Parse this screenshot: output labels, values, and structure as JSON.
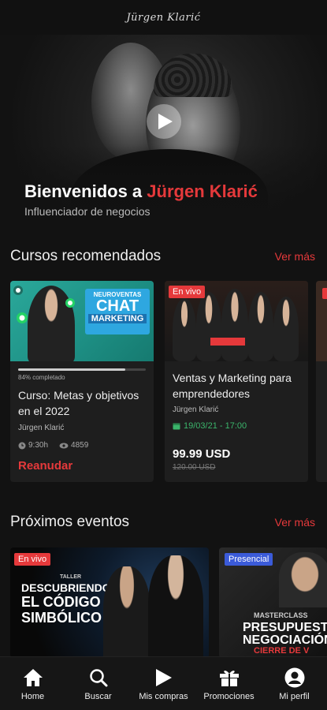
{
  "header": {
    "logo_text": "Jürgen Klarić"
  },
  "hero": {
    "title_prefix": "Bienvenidos a ",
    "title_highlight": "Jürgen Klarić",
    "subtitle": "Influenciador de negocios"
  },
  "courses": {
    "title": "Cursos recomendados",
    "see_more": "Ver más",
    "items": [
      {
        "thumb_small": "NEUROVENTAS",
        "thumb_big": "CHAT",
        "thumb_mid": "MARKETING",
        "progress_fraction": 0.84,
        "progress_label": "84% completado",
        "title": "Curso: Metas y objetivos en el 2022",
        "author": "Jürgen Klarić",
        "duration": "9:30h",
        "views": "4859",
        "action": "Reanudar"
      },
      {
        "badge": "En vivo",
        "title": "Ventas y Marketing para emprendedores",
        "author": "Jürgen Klarić",
        "date": "19/03/21 - 17:00",
        "price": "99.99 USD",
        "old_price": "120.00 USD"
      }
    ]
  },
  "events": {
    "title": "Próximos eventos",
    "see_more": "Ver más",
    "items": [
      {
        "badge": "En vivo",
        "kicker": "TALLER",
        "line1": "DESCUBRIENDO",
        "line2": "EL CÓDIGO",
        "line3": "SIMBÓLICO"
      },
      {
        "badge": "Presencial",
        "kicker": "MASTERCLASS",
        "line1": "PRESUPUESTO",
        "line2": "NEGOCIACIÓN",
        "line3": "CIERRE DE V"
      }
    ]
  },
  "nav": [
    {
      "label": "Home",
      "icon": "home-icon"
    },
    {
      "label": "Buscar",
      "icon": "search-icon"
    },
    {
      "label": "Mis compras",
      "icon": "play-icon"
    },
    {
      "label": "Promociones",
      "icon": "gift-icon"
    },
    {
      "label": "Mi perfil",
      "icon": "profile-icon"
    }
  ],
  "colors": {
    "accent": "#e5393b",
    "date_green": "#3bb56b",
    "badge_blue": "#3b5bd9"
  }
}
